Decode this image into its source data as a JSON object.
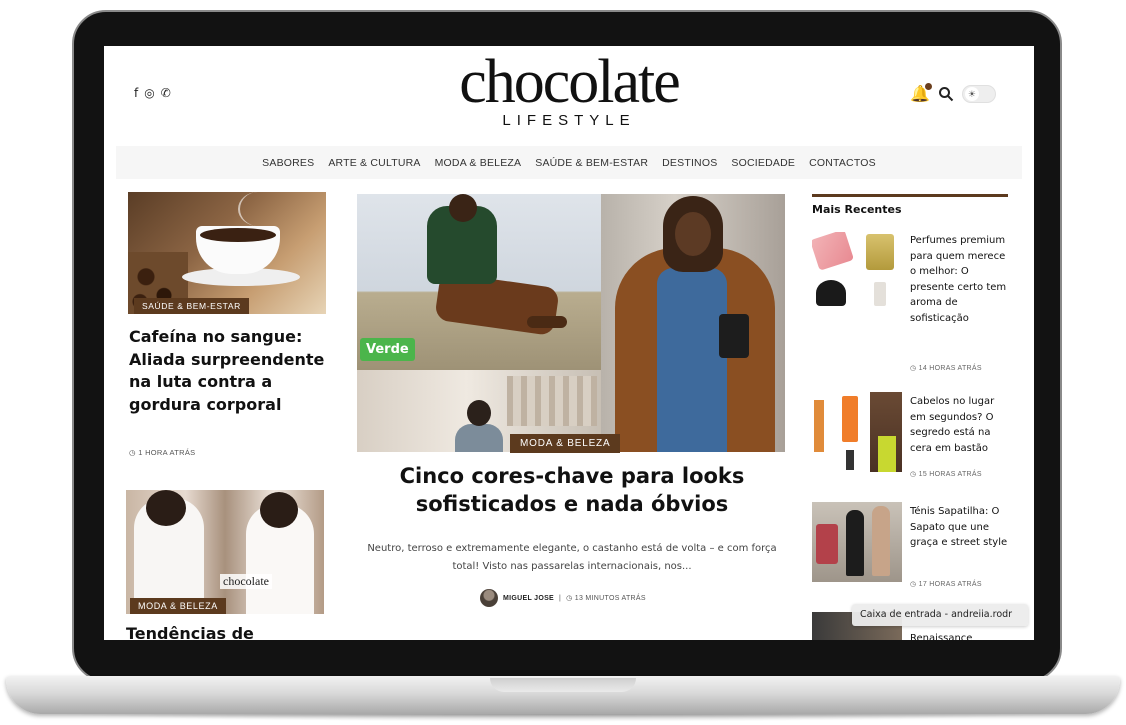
{
  "header": {
    "social_icons": [
      "facebook-icon",
      "instagram-icon",
      "whatsapp-icon"
    ],
    "social_glyphs": [
      "f",
      "◎",
      "✆"
    ],
    "logo_main": "chocolate",
    "logo_sub": "LIFESTYLE"
  },
  "nav": {
    "items": [
      "SABORES",
      "ARTE & CULTURA",
      "MODA & BELEZA",
      "SAÚDE & BEM-ESTAR",
      "DESTINOS",
      "SOCIEDADE",
      "CONTACTOS"
    ]
  },
  "left_column": {
    "card1": {
      "category": "SAÚDE & BEM-ESTAR",
      "title": "Cafeína no sangue: Aliada surpreendente na luta contra a gordura corporal",
      "time": "◷ 1 HORA ATRÁS"
    },
    "card2": {
      "image_text": "chocolate",
      "category": "MODA & BELEZA",
      "title": "Tendências de"
    }
  },
  "featured": {
    "image_tag": "Verde",
    "category": "MODA & BELEZA",
    "title": "Cinco cores-chave para looks sofisticados e nada óbvios",
    "excerpt": "Neutro, terroso e extremamente elegante, o castanho está de volta – e com força total! Visto nas passarelas internacionais, nos...",
    "author": "MIGUEL JOSE",
    "time": "◷ 13 MINUTOS ATRÁS"
  },
  "sidebar": {
    "heading": "Mais Recentes",
    "items": [
      {
        "title": "Perfumes premium para quem merece o melhor: O presente certo tem aroma de sofisticação",
        "time": "◷ 14 HORAS ATRÁS"
      },
      {
        "title": "Cabelos no lugar em segundos? O segredo está na cera em bastão",
        "time": "◷ 15 HORAS ATRÁS"
      },
      {
        "title": "Ténis Sapatilha: O Sapato que une graça e street style",
        "time": "◷ 17 HORAS ATRÁS"
      },
      {
        "title": "Renaissance"
      }
    ]
  },
  "notification": {
    "text": "Caixa de entrada - andreiia.rodr"
  },
  "colors": {
    "accent_brown": "#5c3a1e",
    "verde_tag": "#4bb54b",
    "nav_bg": "#f6f6f6"
  }
}
